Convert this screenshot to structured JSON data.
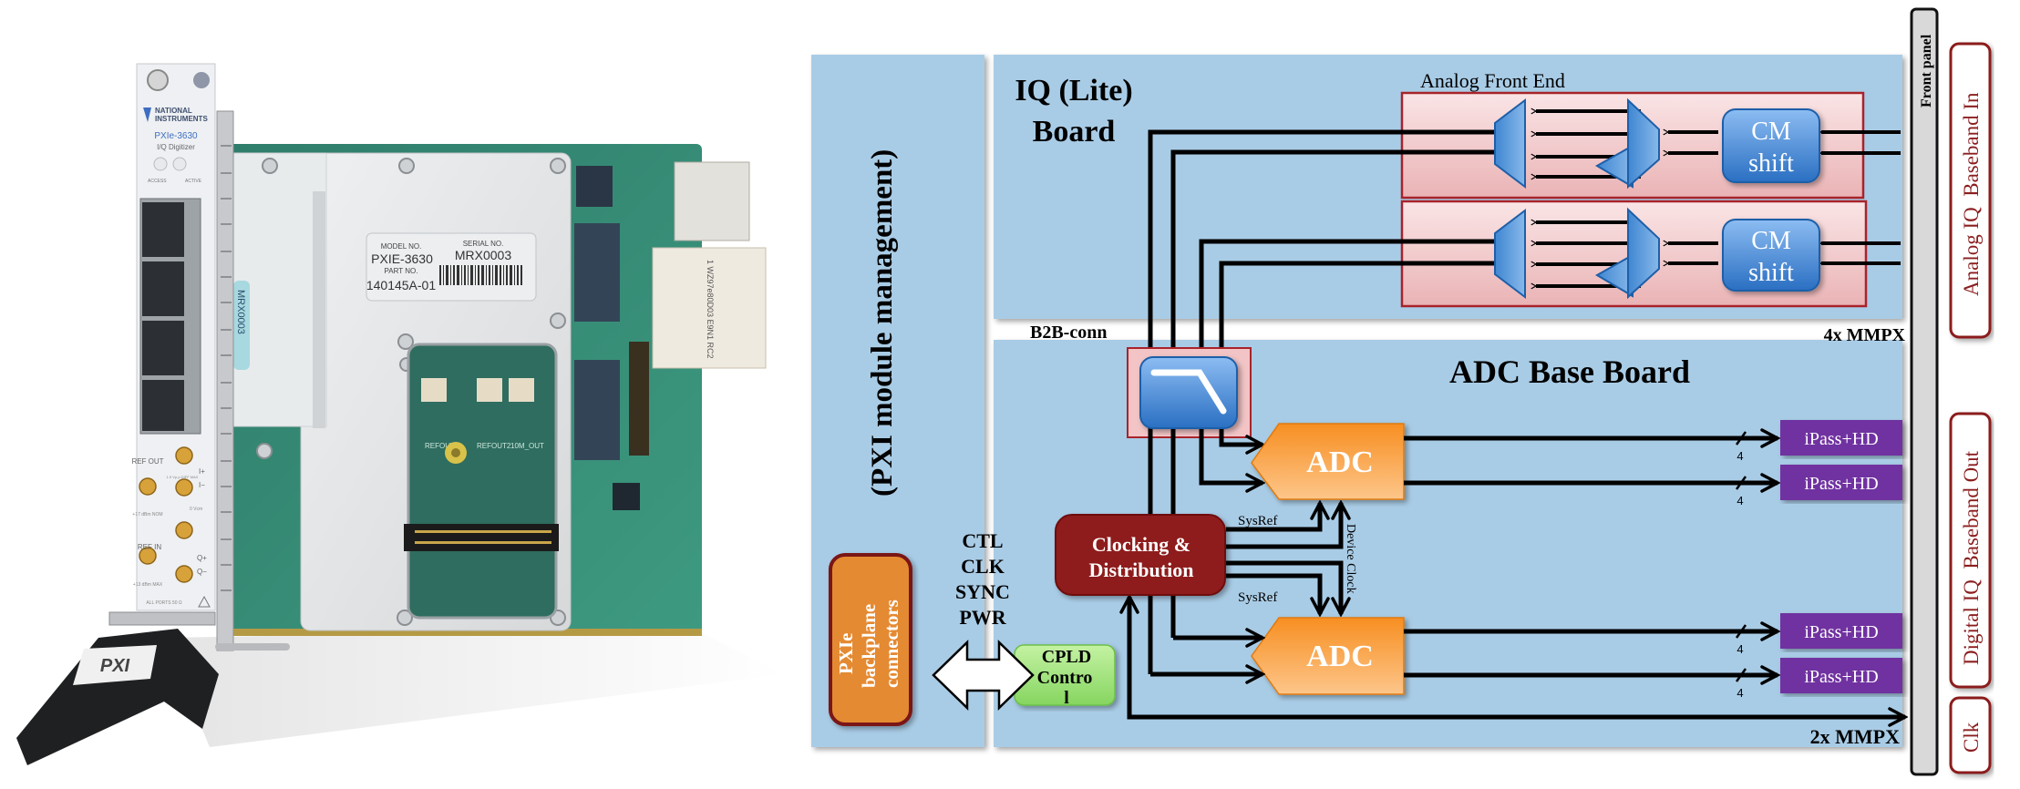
{
  "photo": {
    "faceplate": {
      "brand_line1": "NATIONAL",
      "brand_line2": "INSTRUMENTS",
      "model": "PXIe-3630",
      "subtitle": "I/Q Digitizer",
      "led_left": "ACCESS",
      "led_right": "ACTIVE",
      "ref_out": "REF OUT",
      "ref_out_spec": "+17 dBm NOM",
      "ref_in": "REF IN",
      "ref_in_spec": "+13 dBm MAX",
      "i_plus": "I+",
      "i_minus": "I−",
      "q_plus": "Q+",
      "q_minus": "Q−",
      "diff_spec": "1.5 Vp-p DIFF MAX",
      "vcm": "0 Vcm",
      "all_ports": "ALL PORTS 50 Ω",
      "handle_logo": "PXI"
    },
    "label": {
      "model_no_caption": "MODEL NO.",
      "model_no": "PXIE-3630",
      "part_no_caption": "PART NO.",
      "part_no": "140145A-01",
      "serial_no_caption": "SERIAL NO.",
      "serial_no": "MRX0003"
    },
    "side_tag": "MRX0003",
    "pcb_labels": [
      "REFOUT1",
      "REFOUT2",
      "10M_OUT"
    ],
    "connector_text": "1 WZ97e80D03 E9N1 RC2"
  },
  "diagram": {
    "pxi_management": "(PXI module management)",
    "backplane": "PXIe backplane connectors",
    "bus_signals": [
      "CTL",
      "CLK",
      "SYNC",
      "PWR"
    ],
    "cpld": "CPLD Control",
    "iq_board_title_line1": "IQ (Lite)",
    "iq_board_title_line2": "Board",
    "afe_title": "Analog Front End",
    "cm_shift": "CM shift",
    "b2b": "B2B-conn",
    "mmpx_in": "4x MMPX",
    "adc_board_title": "ADC Base Board",
    "adc": "ADC",
    "clocking_line1": "Clocking &",
    "clocking_line2": "Distribution",
    "sysref": "SysRef",
    "device_clock": "Device Clock",
    "bus_width": "4",
    "ipass": "iPass+HD",
    "mmpx_out": "2x MMPX",
    "front_panel": "Front panel",
    "side_labels": {
      "analog_in": "Analog IQ  Baseband In",
      "digital_out": "Digital IQ  Baseband Out",
      "clk": "Clk"
    },
    "colors": {
      "board_bg": "#a9cce6",
      "afe_fill": "#f3c9cb",
      "afe_border": "#a8232a",
      "blue_block": "#3a86d6",
      "adc_orange": "#f8a24a",
      "clock_red": "#8e1a1a",
      "cpld_green": "#9ee07a",
      "backplane_orange": "#e48a33",
      "ipass_purple": "#7030a0",
      "label_red": "#8b1e1e"
    }
  }
}
